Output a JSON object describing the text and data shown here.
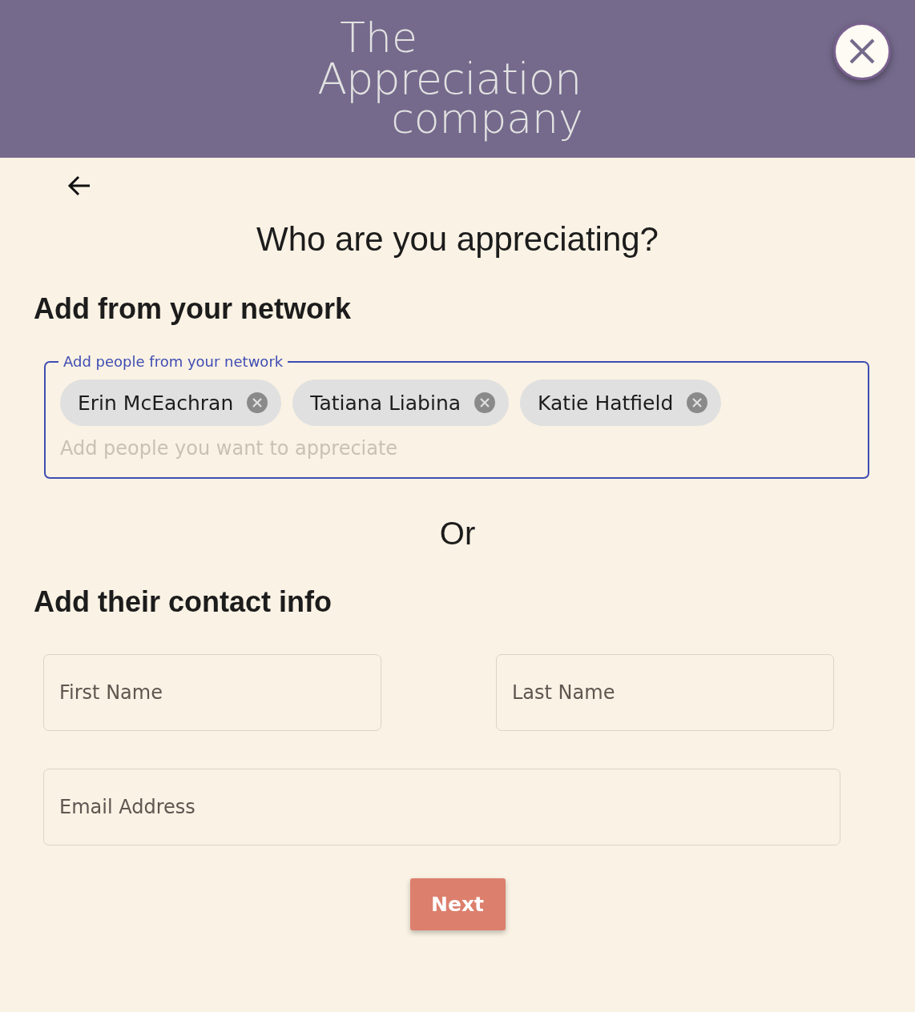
{
  "header": {
    "logo": [
      "The",
      "Appreciation",
      "company"
    ]
  },
  "heading": "Who are you appreciating?",
  "network": {
    "title": "Add from your network",
    "field_label": "Add people from your network",
    "focused": true,
    "chips": [
      {
        "label": "Erin McEachran"
      },
      {
        "label": "Tatiana Liabina"
      },
      {
        "label": "Katie Hatfield"
      }
    ],
    "placeholder": "Add people you want to appreciate"
  },
  "separator": "Or",
  "contact": {
    "title": "Add their contact info",
    "fields": [
      {
        "placeholder": "First Name",
        "kind": "half"
      },
      {
        "placeholder": "Last Name",
        "kind": "half"
      },
      {
        "placeholder": "Email Address",
        "kind": "full"
      }
    ]
  },
  "next_button": "Next"
}
